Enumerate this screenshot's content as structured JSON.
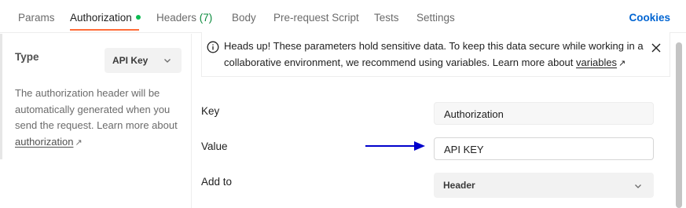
{
  "tabs": [
    {
      "label": "Params"
    },
    {
      "label": "Authorization"
    },
    {
      "label": "Headers",
      "count": "(7)"
    },
    {
      "label": "Body"
    },
    {
      "label": "Pre-request Script"
    },
    {
      "label": "Tests"
    },
    {
      "label": "Settings"
    }
  ],
  "cookies_label": "Cookies",
  "left": {
    "type_label": "Type",
    "type_value": "API Key",
    "help_text": "The authorization header will be automatically generated when you send the request. Learn more about",
    "help_link": "authorization",
    "link_arrow": "↗"
  },
  "notice": {
    "text": "Heads up! These parameters hold sensitive data. To keep this data secure while working in a collaborative environment, we recommend using variables. Learn more about",
    "link": "variables",
    "link_arrow": "↗"
  },
  "form": {
    "key_label": "Key",
    "key_value": "Authorization",
    "value_label": "Value",
    "value_value": "API KEY",
    "addto_label": "Add to",
    "addto_value": "Header"
  },
  "colors": {
    "accent": "#ff6c37",
    "link_blue": "#0265d2",
    "status_green": "#0cbb52",
    "annotation_arrow": "#0000cc"
  }
}
